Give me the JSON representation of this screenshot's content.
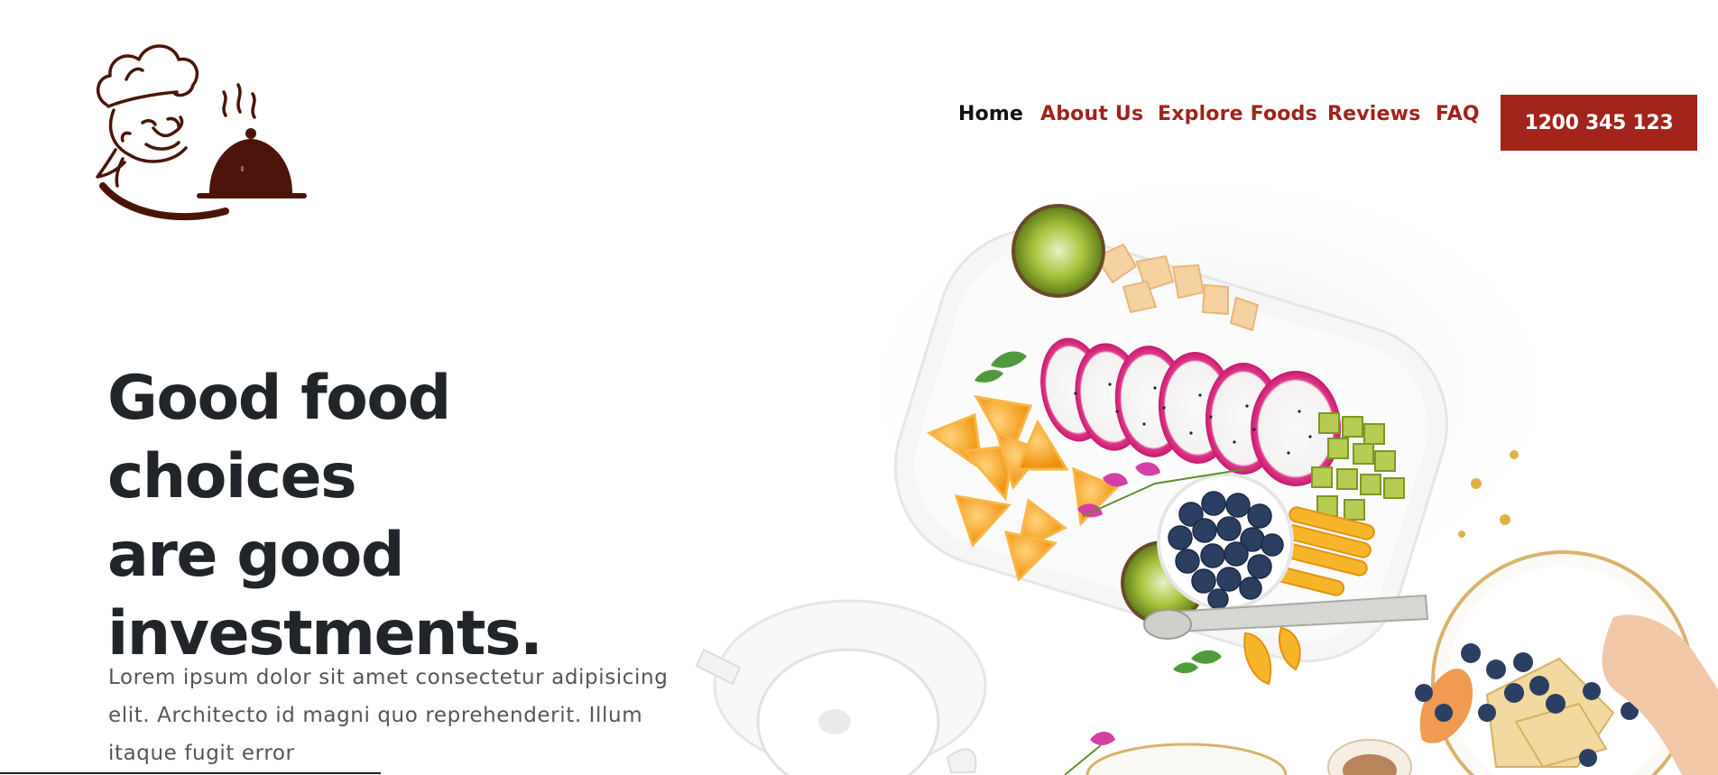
{
  "brand": {
    "logo_icon": "chef-with-cloche-logo",
    "color": "#4a1508"
  },
  "nav": {
    "items": [
      {
        "label": "Home",
        "active": true
      },
      {
        "label": "About Us",
        "active": false
      },
      {
        "label": "Explore Foods",
        "active": false
      },
      {
        "label": "Reviews",
        "active": false
      },
      {
        "label": "FAQ",
        "active": false
      }
    ],
    "active_color": "#111111",
    "link_color": "#a0231b"
  },
  "cta": {
    "phone_label": "1200 345 123",
    "color": "#a1231a"
  },
  "hero": {
    "title_line1": "Good food choices",
    "title_line2": "are good",
    "title_line3": "investments.",
    "text": "Lorem ipsum dolor sit amet consectetur adipisicing elit. Architecto id magni quo reprehenderit. Illum itaque fugit error",
    "image_icon": "fruit-platter-photo"
  }
}
